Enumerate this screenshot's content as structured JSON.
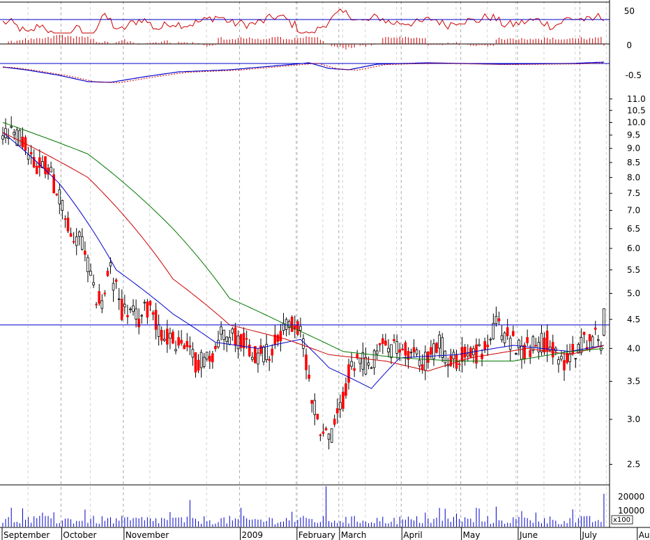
{
  "chart_data": {
    "type": "candlestick",
    "x_month_labels": [
      "September",
      "October",
      "November",
      "2009",
      "February",
      "March",
      "April",
      "May",
      "June",
      "July",
      "August"
    ],
    "price_axis": {
      "scale": "log",
      "ticks": [
        11.0,
        10.5,
        10.0,
        9.5,
        9.0,
        8.5,
        8.0,
        7.5,
        7.0,
        6.5,
        6.0,
        5.5,
        5.0,
        4.5,
        4.0,
        3.5,
        3.0,
        2.5
      ],
      "range": [
        2.3,
        11.7
      ],
      "horizontal_line": 4.4
    },
    "price_keypoints": [
      {
        "day": 0,
        "price": 9.5
      },
      {
        "day": 6,
        "price": 9.4
      },
      {
        "day": 12,
        "price": 8.3
      },
      {
        "day": 16,
        "price": 8.4
      },
      {
        "day": 20,
        "price": 7.3
      },
      {
        "day": 24,
        "price": 6.3
      },
      {
        "day": 28,
        "price": 6.2
      },
      {
        "day": 32,
        "price": 5.0
      },
      {
        "day": 35,
        "price": 4.8
      },
      {
        "day": 38,
        "price": 5.5
      },
      {
        "day": 42,
        "price": 4.7
      },
      {
        "day": 48,
        "price": 4.5
      },
      {
        "day": 52,
        "price": 4.8
      },
      {
        "day": 56,
        "price": 4.2
      },
      {
        "day": 62,
        "price": 4.1
      },
      {
        "day": 68,
        "price": 3.8
      },
      {
        "day": 74,
        "price": 3.9
      },
      {
        "day": 78,
        "price": 4.3
      },
      {
        "day": 82,
        "price": 4.2
      },
      {
        "day": 86,
        "price": 4.1
      },
      {
        "day": 90,
        "price": 3.9
      },
      {
        "day": 95,
        "price": 4.0
      },
      {
        "day": 99,
        "price": 4.4
      },
      {
        "day": 103,
        "price": 4.4
      },
      {
        "day": 106,
        "price": 4.1
      },
      {
        "day": 109,
        "price": 3.3
      },
      {
        "day": 112,
        "price": 2.9
      },
      {
        "day": 116,
        "price": 2.8
      },
      {
        "day": 119,
        "price": 3.1
      },
      {
        "day": 122,
        "price": 3.6
      },
      {
        "day": 126,
        "price": 3.8
      },
      {
        "day": 130,
        "price": 3.7
      },
      {
        "day": 134,
        "price": 4.1
      },
      {
        "day": 138,
        "price": 4.0
      },
      {
        "day": 145,
        "price": 3.9
      },
      {
        "day": 150,
        "price": 3.8
      },
      {
        "day": 154,
        "price": 4.1
      },
      {
        "day": 158,
        "price": 3.8
      },
      {
        "day": 164,
        "price": 3.9
      },
      {
        "day": 170,
        "price": 3.95
      },
      {
        "day": 174,
        "price": 4.4
      },
      {
        "day": 178,
        "price": 4.2
      },
      {
        "day": 183,
        "price": 4.0
      },
      {
        "day": 188,
        "price": 4.05
      },
      {
        "day": 192,
        "price": 4.15
      },
      {
        "day": 196,
        "price": 3.75
      },
      {
        "day": 200,
        "price": 3.9
      },
      {
        "day": 204,
        "price": 4.1
      },
      {
        "day": 208,
        "price": 4.2
      },
      {
        "day": 211,
        "price": 4.15
      },
      {
        "day": 212,
        "price": 4.6
      }
    ],
    "moving_averages": [
      {
        "color": "#0000cc",
        "keypoints": [
          {
            "day": 0,
            "price": 9.6
          },
          {
            "day": 20,
            "price": 7.8
          },
          {
            "day": 40,
            "price": 5.5
          },
          {
            "day": 60,
            "price": 4.6
          },
          {
            "day": 75,
            "price": 4.1
          },
          {
            "day": 90,
            "price": 4.0
          },
          {
            "day": 105,
            "price": 4.15
          },
          {
            "day": 115,
            "price": 3.7
          },
          {
            "day": 130,
            "price": 3.4
          },
          {
            "day": 140,
            "price": 3.85
          },
          {
            "day": 160,
            "price": 3.9
          },
          {
            "day": 180,
            "price": 4.05
          },
          {
            "day": 200,
            "price": 3.95
          },
          {
            "day": 212,
            "price": 4.05
          }
        ]
      },
      {
        "color": "#cc0000",
        "keypoints": [
          {
            "day": 0,
            "price": 9.6
          },
          {
            "day": 30,
            "price": 8.0
          },
          {
            "day": 60,
            "price": 5.3
          },
          {
            "day": 80,
            "price": 4.4
          },
          {
            "day": 100,
            "price": 4.15
          },
          {
            "day": 115,
            "price": 3.9
          },
          {
            "day": 135,
            "price": 3.8
          },
          {
            "day": 150,
            "price": 3.65
          },
          {
            "day": 165,
            "price": 3.85
          },
          {
            "day": 185,
            "price": 4.0
          },
          {
            "day": 200,
            "price": 3.9
          },
          {
            "day": 212,
            "price": 4.05
          }
        ]
      },
      {
        "color": "#007700",
        "keypoints": [
          {
            "day": 0,
            "price": 10.0
          },
          {
            "day": 30,
            "price": 8.8
          },
          {
            "day": 60,
            "price": 6.5
          },
          {
            "day": 80,
            "price": 4.9
          },
          {
            "day": 100,
            "price": 4.4
          },
          {
            "day": 120,
            "price": 3.95
          },
          {
            "day": 140,
            "price": 3.85
          },
          {
            "day": 160,
            "price": 3.8
          },
          {
            "day": 180,
            "price": 3.8
          },
          {
            "day": 200,
            "price": 3.95
          },
          {
            "day": 212,
            "price": 4.0
          }
        ]
      }
    ],
    "rsi_panel": {
      "ticks": [
        50
      ],
      "color": "#cc0000",
      "reference_line": 38
    },
    "macd_hist_panel": {
      "ticks": [
        0
      ],
      "color": "#cc0000"
    },
    "macd_panel": {
      "ticks": [
        -0.5
      ],
      "line_colors": [
        "#0000cc",
        "#cc0000"
      ]
    },
    "volume_panel": {
      "ticks": [
        20000,
        10000
      ],
      "unit_label": "x100",
      "color": "#0000cc"
    }
  },
  "colors": {
    "up_candle": "#ffffff",
    "down_candle": "#ff0000",
    "wick": "#000000",
    "horizontal_line": "#0000cc",
    "grid": "#a8a8a8"
  }
}
